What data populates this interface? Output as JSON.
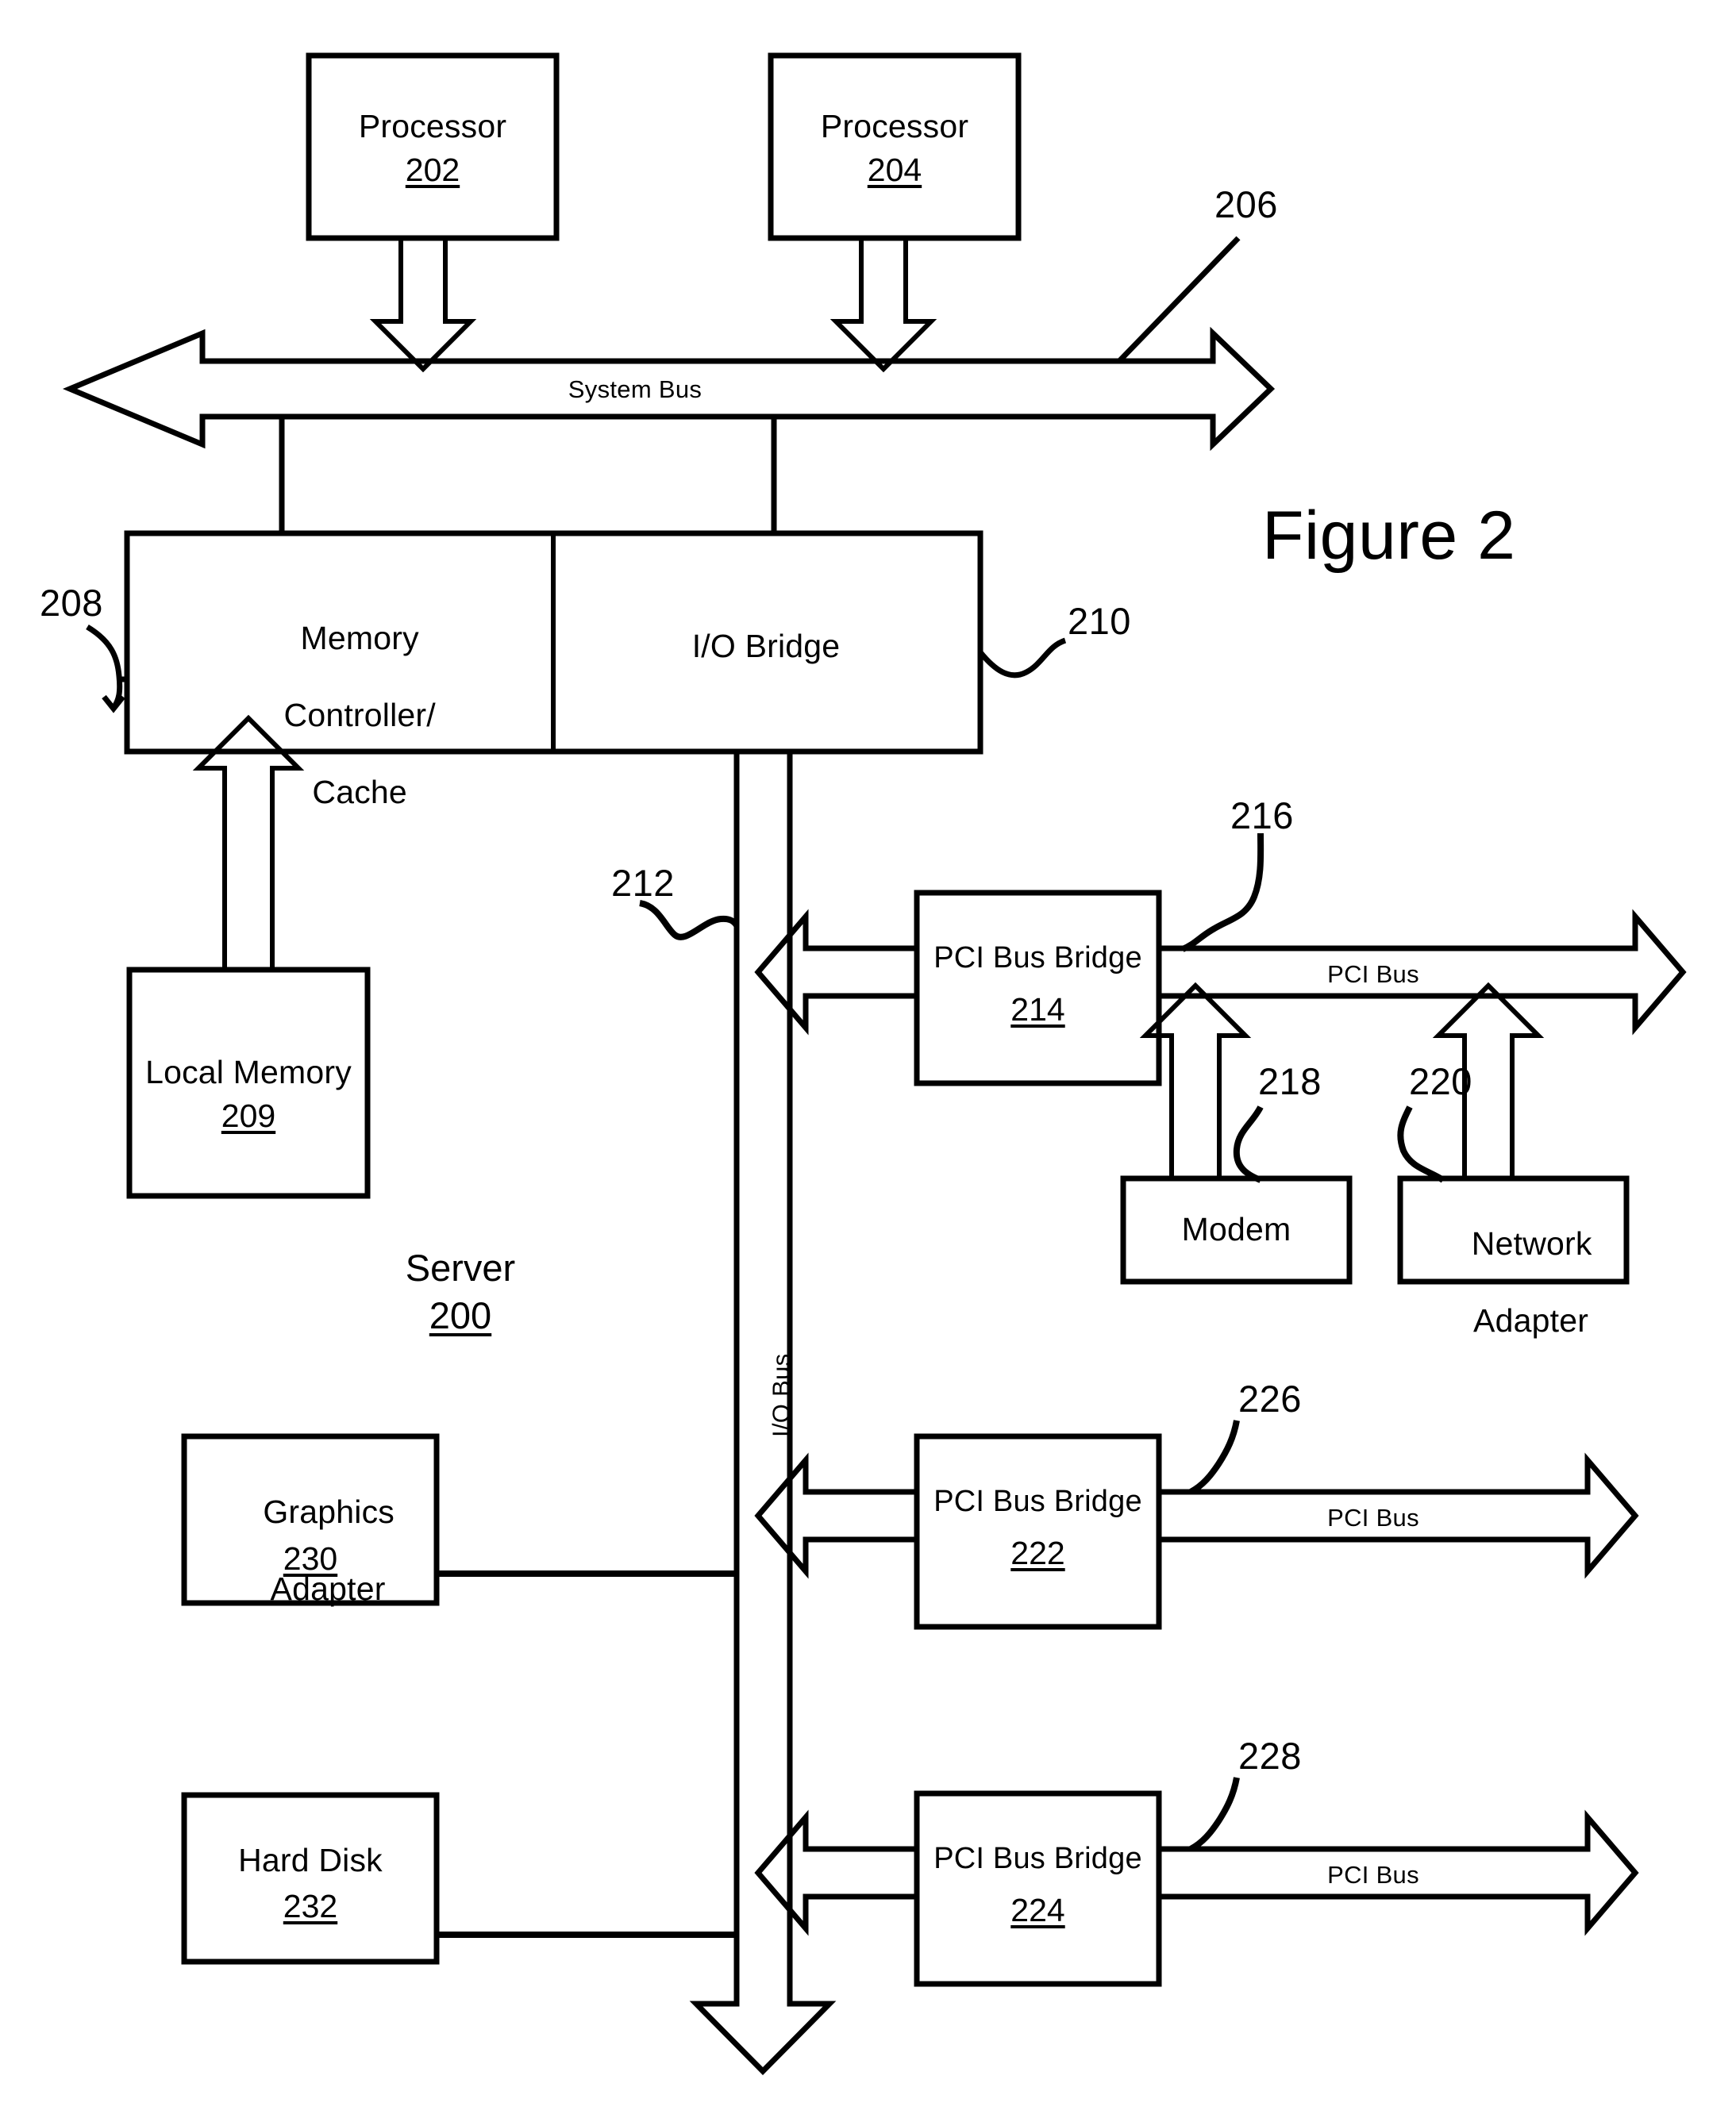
{
  "figure": {
    "title": "Figure 2",
    "system_label": "Server",
    "system_ref": "200"
  },
  "blocks": [
    {
      "id": "processor-1",
      "label": "Processor",
      "ref": "202"
    },
    {
      "id": "processor-2",
      "label": "Processor",
      "ref": "204"
    },
    {
      "id": "memory-controller-cache",
      "label": "Memory\nController/\nCache",
      "ref": ""
    },
    {
      "id": "io-bridge",
      "label": "I/O Bridge",
      "ref": ""
    },
    {
      "id": "local-memory",
      "label": "Local Memory",
      "ref": "209"
    },
    {
      "id": "pci-bus-bridge-1",
      "label": "PCI Bus Bridge",
      "ref": "214"
    },
    {
      "id": "pci-bus-bridge-2",
      "label": "PCI Bus Bridge",
      "ref": "222"
    },
    {
      "id": "pci-bus-bridge-3",
      "label": "PCI Bus Bridge",
      "ref": "224"
    },
    {
      "id": "modem",
      "label": "Modem",
      "ref": ""
    },
    {
      "id": "network-adapter",
      "label": "Network\nAdapter",
      "ref": ""
    },
    {
      "id": "graphics-adapter",
      "label": "Graphics\nAdapter",
      "ref": "230"
    },
    {
      "id": "hard-disk",
      "label": "Hard Disk",
      "ref": "232"
    }
  ],
  "buses": [
    {
      "id": "system-bus",
      "label": "System Bus",
      "ref": "206"
    },
    {
      "id": "io-bus",
      "label": "I/O Bus",
      "ref": "212"
    },
    {
      "id": "pci-bus-1",
      "label": "PCI Bus",
      "ref": "216"
    },
    {
      "id": "pci-bus-2",
      "label": "PCI Bus",
      "ref": "226"
    },
    {
      "id": "pci-bus-3",
      "label": "PCI Bus",
      "ref": "228"
    }
  ],
  "callouts": {
    "c206": "206",
    "c208": "208",
    "c210": "210",
    "c212": "212",
    "c216": "216",
    "c218": "218",
    "c220": "220",
    "c226": "226",
    "c228": "228"
  },
  "text": {
    "processor1_label": "Processor",
    "processor1_ref": "202",
    "processor2_label": "Processor",
    "processor2_ref": "204",
    "memctl_line1": "Memory",
    "memctl_line2": "Controller/",
    "memctl_line3": "Cache",
    "iobridge_label": "I/O Bridge",
    "localmem_label": "Local Memory",
    "localmem_ref": "209",
    "pcibridge1_label": "PCI Bus Bridge",
    "pcibridge1_ref": "214",
    "pcibridge2_label": "PCI Bus Bridge",
    "pcibridge2_ref": "222",
    "pcibridge3_label": "PCI Bus Bridge",
    "pcibridge3_ref": "224",
    "modem_label": "Modem",
    "netadapter_line1": "Network",
    "netadapter_line2": "Adapter",
    "graphics_line1": "Graphics",
    "graphics_line2": "Adapter",
    "graphics_ref": "230",
    "harddisk_label": "Hard Disk",
    "harddisk_ref": "232",
    "systembus_label": "System Bus",
    "iobus_label": "I/O Bus",
    "pcibus1_label": "PCI Bus",
    "pcibus2_label": "PCI Bus",
    "pcibus3_label": "PCI Bus",
    "server_label": "Server",
    "server_ref": "200",
    "figure_title": "Figure 2"
  },
  "colors": {
    "stroke": "#000000",
    "background": "#ffffff"
  }
}
